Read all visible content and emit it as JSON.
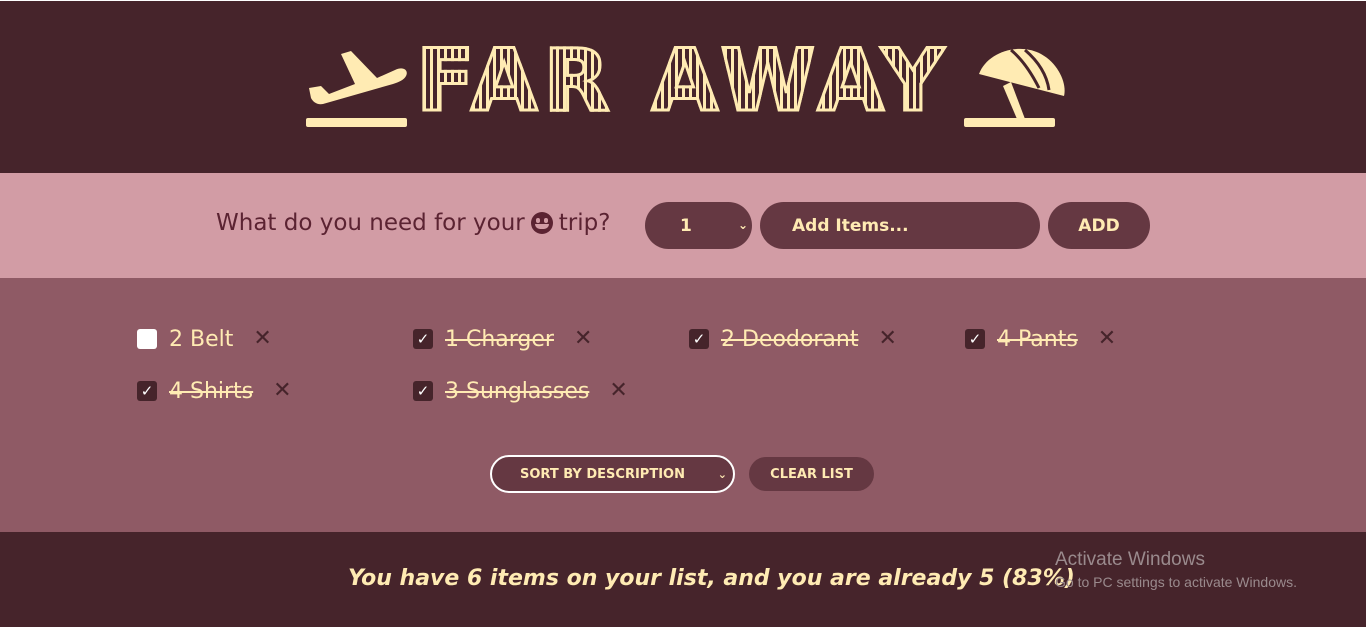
{
  "header": {
    "title": "FAR AWAY",
    "left_icon": "airplane-departure-icon",
    "right_icon": "beach-umbrella-icon"
  },
  "form": {
    "question": "What do you need for your",
    "question_suffix": "trip?",
    "emoji_icon": "smiling-face-icon",
    "quantity": "1",
    "item_placeholder": "Add Items...",
    "add_label": "ADD"
  },
  "items": [
    {
      "text": "2 Belt",
      "packed": false
    },
    {
      "text": "1 Charger",
      "packed": true
    },
    {
      "text": "2 Deodorant",
      "packed": true
    },
    {
      "text": "4 Pants",
      "packed": true
    },
    {
      "text": "4 Shirts",
      "packed": true
    },
    {
      "text": "3 Sunglasses",
      "packed": true
    }
  ],
  "actions": {
    "sort_value": "SORT BY DESCRIPTION",
    "clear_label": "CLEAR LIST"
  },
  "footer": {
    "stats": "You have 6 items on your list, and you are already 5 (83%)"
  },
  "overlay": {
    "activate_title": "Activate Windows",
    "activate_sub": "Go to PC settings to activate Windows."
  },
  "colors": {
    "header_bg": "#46242b",
    "form_bg": "#d29ca5",
    "list_bg": "#8f5a65",
    "accent_text": "#ffebb3",
    "control_bg": "#653842"
  }
}
